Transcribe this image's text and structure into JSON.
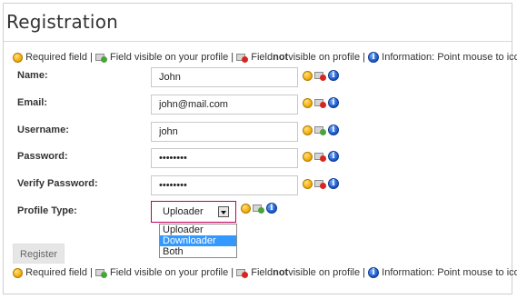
{
  "title": "Registration",
  "legend": {
    "required": "Required field |",
    "visible": "Field visible on your profile |",
    "not_visible_pre": "Field ",
    "not_visible_bold": "not",
    "not_visible_post": " visible on profile |",
    "information": "Information: Point mouse to icon"
  },
  "fields": {
    "name": {
      "label": "Name:",
      "value": "John"
    },
    "email": {
      "label": "Email:",
      "value": "john@mail.com"
    },
    "username": {
      "label": "Username:",
      "value": "john"
    },
    "password": {
      "label": "Password:",
      "value": "••••••••"
    },
    "verify": {
      "label": "Verify Password:",
      "value": "••••••••"
    }
  },
  "profile_type": {
    "label": "Profile Type:",
    "selected": "Uploader",
    "options": [
      "Uploader",
      "Downloader",
      "Both"
    ],
    "highlighted": "Downloader"
  },
  "submit_label": "Register",
  "icons": {
    "required": "required-icon",
    "visible": "visible-on-profile-icon",
    "not_visible": "not-visible-on-profile-icon",
    "info": "info-icon"
  }
}
